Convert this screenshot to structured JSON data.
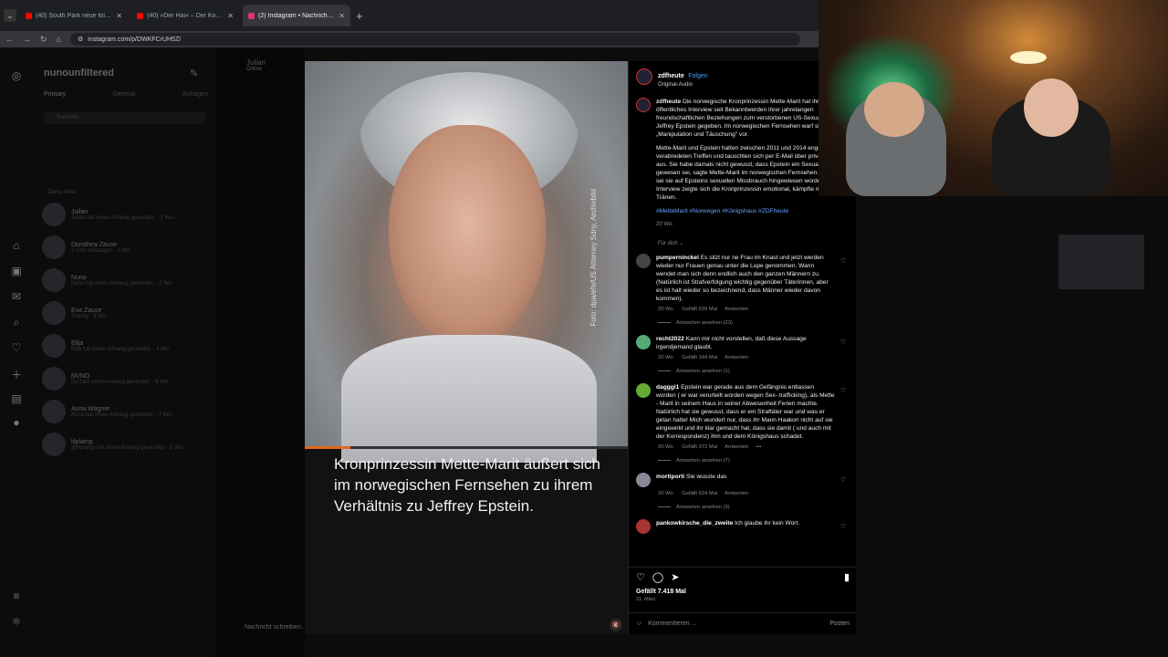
{
  "browser": {
    "tabs": [
      {
        "label": "(40) South Park neue folgen - Yo",
        "active": false,
        "favicon_color": "#ff0000"
      },
      {
        "label": "(40) »Der Hai« – Der Kokobaro",
        "active": false,
        "favicon_color": "#ff0000"
      },
      {
        "label": "(2) Instagram • Nachrichten",
        "active": true,
        "favicon_color": "#e1306c"
      }
    ],
    "url": "instagram.com/p/DWKFCrUH5Z/"
  },
  "dm": {
    "account": "nunounfiltered",
    "tabs": [
      "Primary",
      "General",
      "Anfragen"
    ],
    "search_placeholder": "Suchen",
    "note_label": "Deine Notiz",
    "conversations": [
      {
        "name": "Julian",
        "preview": "Julian hat einen Anhang gesendet. · 1 Wo."
      },
      {
        "name": "Dorothea Zause",
        "preview": "2 new messages · 2 Wo."
      },
      {
        "name": "Nuno",
        "preview": "Nuno hat einen Anhang gesendet. · 2 Wo."
      },
      {
        "name": "Eva Zause",
        "preview": "Traurig · 3 Wo."
      },
      {
        "name": "Elija",
        "preview": "Elija hat einen Anhang gesendet. · 4 Wo."
      },
      {
        "name": "NVNO",
        "preview": "Du hast einen Anhang gesendet. · 6 Wo."
      },
      {
        "name": "Anna Wagner",
        "preview": "Anna hat einen Anhang gesendet. · 7 Wo."
      },
      {
        "name": "lilplamp",
        "preview": "@lilplamp hat einen Anhang gesendet. · 5 Wo."
      }
    ],
    "chat_title": "Julian",
    "chat_status": "Online",
    "message_placeholder": "Nachricht schreiben ..."
  },
  "media": {
    "credit": "Foto: dpa/efe/US Attorney Sdny, Archivbild",
    "caption": "Kronprinzessin Mette-Marit äußert sich im norwegischen Fernsehen zu ihrem Verhältnis zu Jeffrey Epstein.",
    "progress": 0.14
  },
  "post": {
    "author": "zdfheute",
    "follow": "Folgen",
    "audio": "Original-Audio",
    "caption_p1": "Die norwegische Kronprinzessin Mette-Marit hat ihr erstes öffentliches Interview seit Bekanntwerden ihrer jahrelangen freundschaftlichen Beziehungen zum verstorbenen US-Sexualstraftäter Jeffrey Epstein gegeben. Im norwegischen Fernsehen warf sie Epstein „Manipulation und Täuschung\" vor.",
    "caption_p2": "Mette-Marit und Epstein hatten zwischen 2011 und 2014 engen Kontakt, verabredeten Treffen und tauschten sich per E-Mail über private Dinge aus. Sie habe damals nicht gewusst, dass Epstein ein Sexualverbrecher gewesen sei, sagte Mette-Marit im norwegischen Fernsehen. Erst 2019 sei sie auf Epsteins sexuellen Missbrauch hingewiesen worden. Im Interview zeigte sich die Kronprinzessin emotional, kämpfte mit den Tränen.",
    "hashtags": "#MetteMarit #Norwegen #Königshaus #ZDFheute",
    "caption_age": "20 Wo.",
    "sort_label": "Für dich",
    "comments": [
      {
        "user": "pumperninckel",
        "text": "Es sitzt nur ne Frau im Knast und jetzt werden wieder nur Frauen genau unter die Lupe genommen. Wann wendet man sich denn endlich auch den ganzen Männern zu. (Natürlich ist Strafverfolgung wichtig gegenüber Täterinnen, aber es ist halt wieder so bezeichnend, dass Männer wieder davon kommen).",
        "age": "20 Wo.",
        "likes": "Gefällt 639 Mal",
        "reply": "Antworten",
        "replies": "Antworten ansehen (23)"
      },
      {
        "user": "recht2022",
        "text": "Kann mir nicht vorstellen, daß diese Aussage irgendjemand glaubt.",
        "age": "20 Wo.",
        "likes": "Gefällt 344 Mal",
        "reply": "Antworten",
        "replies": "Antworten ansehen (1)"
      },
      {
        "user": "dagggi1",
        "text": "Epstein war gerade aus dem Gefängnis entlassen worden ( er war verurteilt worden wegen Sex- trafficking), als Mette - Marit in seinem Haus in seiner Abwesenheit Ferien machte. Natürlich hat sie gewusst, dass er ein Straftäter war und was er getan hatte! Mich wundert nur, dass ihr Mann Haakon nicht auf sie eingewirkt und ihr klar gemacht hat, dass sie damit ( und auch mit der Korrespondenz) ihm und dem Königshaus schadet.",
        "age": "20 Wo.",
        "likes": "Gefällt 372 Mal",
        "reply": "Antworten",
        "replies": "Antworten ansehen (7)"
      },
      {
        "user": "mortiporti",
        "text": "Sie wusste das",
        "age": "20 Wo.",
        "likes": "Gefällt 624 Mal",
        "reply": "Antworten",
        "replies": "Antworten ansehen (3)"
      },
      {
        "user": "pankowkirsche_die_zweite",
        "text": "Ich glaube ihr kein Wort.",
        "age": "",
        "likes": "",
        "reply": "",
        "replies": ""
      }
    ],
    "like_count": "Gefällt 7.418 Mal",
    "date": "21. März",
    "comment_placeholder": "Kommentieren ...",
    "post_button": "Posten"
  },
  "colors": {
    "accent": "#4a9eff",
    "progress": "#e06a1a",
    "ig_bg": "#0c0c0c"
  }
}
